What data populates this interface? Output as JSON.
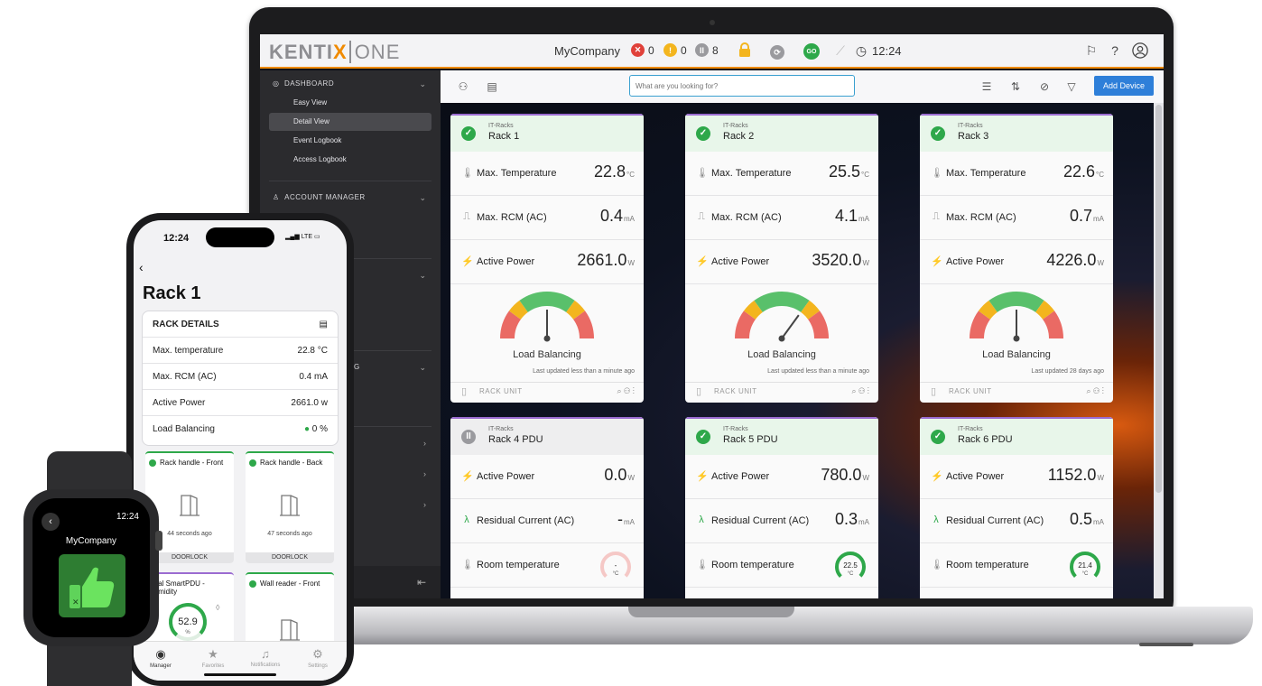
{
  "colors": {
    "accent": "#f08a00",
    "ok": "#2ea84a",
    "primary": "#2e7fd9",
    "error": "#e0413a",
    "warning": "#f3b51e",
    "sidebar": "#2b2b2e"
  },
  "topbar": {
    "logo_main": "KENTI",
    "logo_x": "X",
    "logo_one": "ONE",
    "company": "MyCompany",
    "alarms": {
      "error_count": "0",
      "warning_count": "0",
      "paused_count": "8"
    },
    "go_badge": "GO",
    "time": "12:24",
    "icons": [
      "lock-icon",
      "refresh-icon",
      "signal-off-icon",
      "clock-icon",
      "megaphone-icon",
      "help-icon",
      "user-icon"
    ]
  },
  "sidebar": {
    "dashboard_label": "DASHBOARD",
    "items": [
      "Easy View",
      "Detail View",
      "Event Logbook",
      "Access Logbook"
    ],
    "active_index": 1,
    "account_manager_label": "ACCOUNT MANAGER",
    "partial_label": "G"
  },
  "toolbar": {
    "search_placeholder": "What are you looking for?",
    "add_device": "Add Device"
  },
  "cards": [
    {
      "category": "IT-Racks",
      "name": "Rack 1",
      "status": "ok",
      "rows": [
        {
          "icon": "thermometer-icon",
          "label": "Max. Temperature",
          "value": "22.8",
          "unit": "°C"
        },
        {
          "icon": "rcm-icon",
          "label": "Max. RCM (AC)",
          "value": "0.4",
          "unit": "mA"
        },
        {
          "icon": "plug-icon",
          "label": "Active Power",
          "value": "2661.0",
          "unit": "W"
        }
      ],
      "gauge_label": "Load Balancing",
      "gauge_level": 0.5,
      "updated": "Last updated less than a minute ago",
      "footer": "RACK UNIT"
    },
    {
      "category": "IT-Racks",
      "name": "Rack 2",
      "status": "ok",
      "rows": [
        {
          "icon": "thermometer-icon",
          "label": "Max. Temperature",
          "value": "25.5",
          "unit": "°C"
        },
        {
          "icon": "rcm-icon",
          "label": "Max. RCM (AC)",
          "value": "4.1",
          "unit": "mA"
        },
        {
          "icon": "plug-icon",
          "label": "Active Power",
          "value": "3520.0",
          "unit": "W"
        }
      ],
      "gauge_label": "Load Balancing",
      "gauge_level": 0.7,
      "updated": "Last updated less than a minute ago",
      "footer": "RACK UNIT"
    },
    {
      "category": "IT-Racks",
      "name": "Rack 3",
      "status": "ok",
      "rows": [
        {
          "icon": "thermometer-icon",
          "label": "Max. Temperature",
          "value": "22.6",
          "unit": "°C"
        },
        {
          "icon": "rcm-icon",
          "label": "Max. RCM (AC)",
          "value": "0.7",
          "unit": "mA"
        },
        {
          "icon": "plug-icon",
          "label": "Active Power",
          "value": "4226.0",
          "unit": "W"
        }
      ],
      "gauge_label": "Load Balancing",
      "gauge_level": 0.5,
      "updated": "Last updated 28 days ago",
      "footer": "RACK UNIT"
    },
    {
      "category": "IT-Racks",
      "name": "Rack 4 PDU",
      "status": "paused",
      "rows": [
        {
          "icon": "plug-icon",
          "label": "Active Power",
          "value": "0.0",
          "unit": "W"
        },
        {
          "icon": "lambda-icon",
          "label": "Residual Current (AC)",
          "value": "-",
          "unit": "mA"
        },
        {
          "icon": "thermometer-icon",
          "label": "Room temperature",
          "value": "-",
          "unit": "°C"
        }
      ]
    },
    {
      "category": "IT-Racks",
      "name": "Rack 5 PDU",
      "status": "ok",
      "rows": [
        {
          "icon": "plug-icon",
          "label": "Active Power",
          "value": "780.0",
          "unit": "W"
        },
        {
          "icon": "lambda-icon",
          "label": "Residual Current (AC)",
          "value": "0.3",
          "unit": "mA"
        },
        {
          "icon": "thermometer-icon",
          "label": "Room temperature",
          "value": "22.5",
          "unit": "°C"
        }
      ]
    },
    {
      "category": "IT-Racks",
      "name": "Rack 6 PDU",
      "status": "ok",
      "rows": [
        {
          "icon": "plug-icon",
          "label": "Active Power",
          "value": "1152.0",
          "unit": "W"
        },
        {
          "icon": "lambda-icon",
          "label": "Residual Current (AC)",
          "value": "0.5",
          "unit": "mA"
        },
        {
          "icon": "thermometer-icon",
          "label": "Room temperature",
          "value": "21.4",
          "unit": "°C"
        }
      ]
    }
  ],
  "phone": {
    "time": "12:24",
    "network": "LTE",
    "title": "Rack 1",
    "details_label": "RACK DETAILS",
    "details": [
      {
        "label": "Max. temperature",
        "value": "22.8 °C"
      },
      {
        "label": "Max. RCM (AC)",
        "value": "0.4 mA"
      },
      {
        "label": "Active Power",
        "value": "2661.0 w"
      },
      {
        "label": "Load Balancing",
        "value": "0 %"
      }
    ],
    "tiles": [
      {
        "title": "Rack handle - Front",
        "ago": "44 seconds ago",
        "footer": "DOORLOCK"
      },
      {
        "title": "Rack handle - Back",
        "ago": "47 seconds ago",
        "footer": "DOORLOCK"
      },
      {
        "title": "Dual SmartPDU - Humidity",
        "value": "52.9",
        "unit": "%"
      },
      {
        "title": "Wall reader - Front"
      }
    ],
    "tabs": [
      "Manager",
      "Favorites",
      "Notifications",
      "Settings"
    ]
  },
  "watch": {
    "time": "12:24",
    "company": "MyCompany"
  }
}
